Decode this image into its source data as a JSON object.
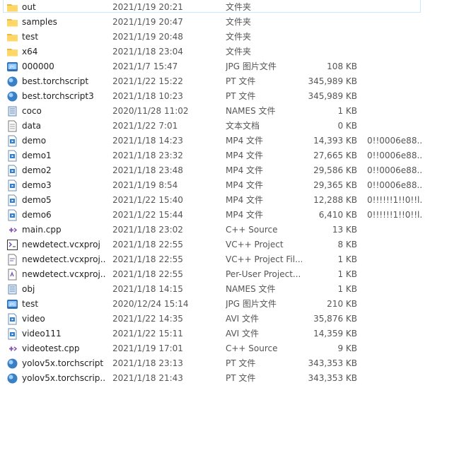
{
  "rows": [
    {
      "name": "out",
      "date": "2021/1/19 20:21",
      "type": "文件夹",
      "size": "",
      "extra": "",
      "icon": "folder-icon",
      "selected": true
    },
    {
      "name": "samples",
      "date": "2021/1/19 20:47",
      "type": "文件夹",
      "size": "",
      "extra": "",
      "icon": "folder-icon"
    },
    {
      "name": "test",
      "date": "2021/1/19 20:48",
      "type": "文件夹",
      "size": "",
      "extra": "",
      "icon": "folder-icon"
    },
    {
      "name": "x64",
      "date": "2021/1/18 23:04",
      "type": "文件夹",
      "size": "",
      "extra": "",
      "icon": "folder-icon"
    },
    {
      "name": "000000",
      "date": "2021/1/7 15:47",
      "type": "JPG 图片文件",
      "size": "108 KB",
      "extra": "",
      "icon": "jpg-file-icon"
    },
    {
      "name": "best.torchscript",
      "date": "2021/1/22 15:22",
      "type": "PT 文件",
      "size": "345,989 KB",
      "extra": "",
      "icon": "pt-file-icon"
    },
    {
      "name": "best.torchscript3",
      "date": "2021/1/18 10:23",
      "type": "PT 文件",
      "size": "345,989 KB",
      "extra": "",
      "icon": "pt-file-icon"
    },
    {
      "name": "coco",
      "date": "2020/11/28 11:02",
      "type": "NAMES 文件",
      "size": "1 KB",
      "extra": "",
      "icon": "names-file-icon"
    },
    {
      "name": "data",
      "date": "2021/1/22 7:01",
      "type": "文本文档",
      "size": "0 KB",
      "extra": "",
      "icon": "text-file-icon"
    },
    {
      "name": "demo",
      "date": "2021/1/18 14:23",
      "type": "MP4 文件",
      "size": "14,393 KB",
      "extra": "0!!0006e88...",
      "icon": "video-file-icon"
    },
    {
      "name": "demo1",
      "date": "2021/1/18 23:32",
      "type": "MP4 文件",
      "size": "27,665 KB",
      "extra": "0!!0006e88...",
      "icon": "video-file-icon"
    },
    {
      "name": "demo2",
      "date": "2021/1/18 23:48",
      "type": "MP4 文件",
      "size": "29,586 KB",
      "extra": "0!!0006e88...",
      "icon": "video-file-icon"
    },
    {
      "name": "demo3",
      "date": "2021/1/19 8:54",
      "type": "MP4 文件",
      "size": "29,365 KB",
      "extra": "0!!0006e88...",
      "icon": "video-file-icon"
    },
    {
      "name": "demo5",
      "date": "2021/1/22 15:40",
      "type": "MP4 文件",
      "size": "12,288 KB",
      "extra": "0!!!!!!1!!0!!l...",
      "icon": "video-file-icon"
    },
    {
      "name": "demo6",
      "date": "2021/1/22 15:44",
      "type": "MP4 文件",
      "size": "6,410 KB",
      "extra": "0!!!!!!1!!0!!l...",
      "icon": "video-file-icon"
    },
    {
      "name": "main.cpp",
      "date": "2021/1/18 23:02",
      "type": "C++ Source",
      "size": "13 KB",
      "extra": "",
      "icon": "cpp-file-icon"
    },
    {
      "name": "newdetect.vcxproj",
      "date": "2021/1/18 22:55",
      "type": "VC++ Project",
      "size": "8 KB",
      "extra": "",
      "icon": "vcxproj-file-icon"
    },
    {
      "name": "newdetect.vcxproj...",
      "date": "2021/1/18 22:55",
      "type": "VC++ Project Fil...",
      "size": "1 KB",
      "extra": "",
      "icon": "filters-file-icon"
    },
    {
      "name": "newdetect.vcxproj...",
      "date": "2021/1/18 22:55",
      "type": "Per-User Project...",
      "size": "1 KB",
      "extra": "",
      "icon": "user-file-icon"
    },
    {
      "name": "obj",
      "date": "2021/1/18 14:15",
      "type": "NAMES 文件",
      "size": "1 KB",
      "extra": "",
      "icon": "names-file-icon"
    },
    {
      "name": "test",
      "date": "2020/12/24 15:14",
      "type": "JPG 图片文件",
      "size": "210 KB",
      "extra": "",
      "icon": "jpg-file-icon"
    },
    {
      "name": "video",
      "date": "2021/1/22 14:35",
      "type": "AVI 文件",
      "size": "35,876 KB",
      "extra": "",
      "icon": "video-file-icon"
    },
    {
      "name": "video111",
      "date": "2021/1/22 15:11",
      "type": "AVI 文件",
      "size": "14,359 KB",
      "extra": "",
      "icon": "video-file-icon"
    },
    {
      "name": "videotest.cpp",
      "date": "2021/1/19 17:01",
      "type": "C++ Source",
      "size": "9 KB",
      "extra": "",
      "icon": "cpp-file-icon"
    },
    {
      "name": "yolov5x.torchscript",
      "date": "2021/1/18 23:13",
      "type": "PT 文件",
      "size": "343,353 KB",
      "extra": "",
      "icon": "pt-file-icon"
    },
    {
      "name": "yolov5x.torchscrip...",
      "date": "2021/1/18 21:43",
      "type": "PT 文件",
      "size": "343,353 KB",
      "extra": "",
      "icon": "pt-file-icon"
    }
  ]
}
